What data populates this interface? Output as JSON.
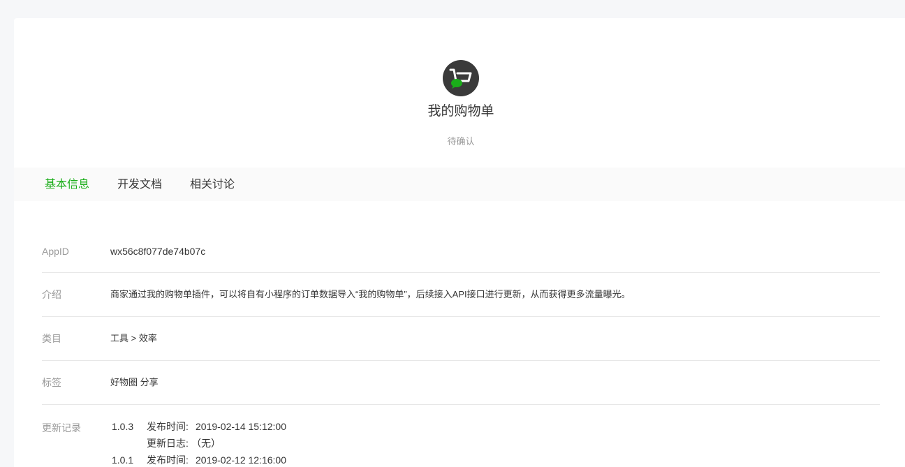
{
  "app": {
    "name": "我的购物单",
    "status": "待确认",
    "logo_icon": "shopping-cart-icon"
  },
  "tabs": [
    {
      "label": "基本信息",
      "active": true
    },
    {
      "label": "开发文档",
      "active": false
    },
    {
      "label": "相关讨论",
      "active": false
    }
  ],
  "info": {
    "appid": {
      "label": "AppID",
      "value": "wx56c8f077de74b07c"
    },
    "intro": {
      "label": "介绍",
      "value": "商家通过我的购物单插件，可以将自有小程序的订单数据导入“我的购物单”，后续接入API接口进行更新，从而获得更多流量曝光。"
    },
    "category": {
      "label": "类目",
      "value": "工具 > 效率"
    },
    "tags": {
      "label": "标签",
      "value": "好物圈 分享"
    },
    "changelog": {
      "label": "更新记录",
      "entries": [
        {
          "version": "1.0.3",
          "time_label": "发布时间:",
          "time": "2019-02-14 15:12:00",
          "log_label": "更新日志:",
          "log": "（无）"
        },
        {
          "version": "1.0.1",
          "time_label": "发布时间:",
          "time": "2019-02-12 12:16:00"
        }
      ]
    }
  },
  "colors": {
    "accent": "#1aad19",
    "page_bg": "#f6f7f9",
    "tab_bar_bg": "#fafafa",
    "muted_text": "#9a9a9a"
  }
}
